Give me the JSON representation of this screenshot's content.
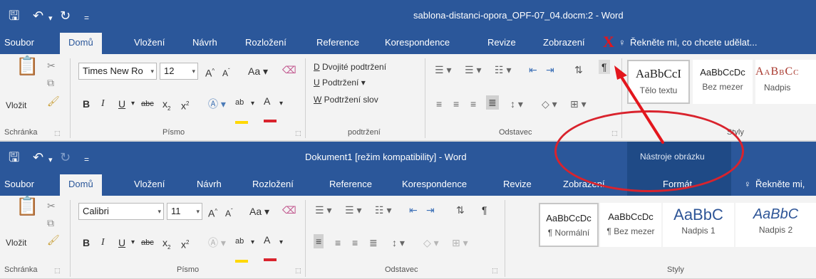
{
  "top_window": {
    "title": "sablona-distanci-opora_OPF-07_04.docm:2 - Word",
    "tabs": [
      "Soubor",
      "Domů",
      "Vložení",
      "Návrh",
      "Rozložení",
      "Reference",
      "Korespondence",
      "Revize",
      "Zobrazení"
    ],
    "tell_me": "Řekněte mi, co chcete udělat...",
    "clipboard": {
      "paste": "Vložit",
      "label": "Schránka"
    },
    "font": {
      "name": "Times New Ro",
      "size": "12",
      "change_case": "Aa",
      "label": "Písmo"
    },
    "underline_group": {
      "double": "Dvojité podtržení",
      "single": "Podtržení",
      "words": "Podtržení slov",
      "key_double": "D",
      "key_single": "U",
      "key_words": "W",
      "label": "podtržení"
    },
    "paragraph": {
      "label": "Odstavec"
    },
    "styles": {
      "items": [
        {
          "sample": "AaBbCcI",
          "name": "Tělo textu"
        },
        {
          "sample": "AaBbCcDc",
          "name": "Bez mezer"
        },
        {
          "sample": "AaBbCc",
          "name": "Nadpis"
        }
      ],
      "label": "Styly"
    }
  },
  "bottom_window": {
    "title": "Dokument1 [režim kompatibility] - Word",
    "contextual_group": "Nástroje obrázku",
    "tabs": [
      "Soubor",
      "Domů",
      "Vložení",
      "Návrh",
      "Rozložení",
      "Reference",
      "Korespondence",
      "Revize",
      "Zobrazení",
      "Formát"
    ],
    "tell_me": "Řekněte mi,",
    "clipboard": {
      "paste": "Vložit",
      "label": "Schránka"
    },
    "font": {
      "name": "Calibri",
      "size": "11",
      "change_case": "Aa",
      "label": "Písmo"
    },
    "paragraph": {
      "label": "Odstavec"
    },
    "styles": {
      "items": [
        {
          "sample": "AaBbCcDc",
          "name": "¶ Normální"
        },
        {
          "sample": "AaBbCcDc",
          "name": "¶ Bez mezer"
        },
        {
          "sample": "AaBbC",
          "name": "Nadpis 1"
        },
        {
          "sample": "AaBbC",
          "name": "Nadpis 2"
        }
      ],
      "label": "Styly"
    }
  },
  "annotation": {
    "mark": "X",
    "color": "#e3161d"
  },
  "colors": {
    "title_bar": "#2b579a",
    "ribbon": "#f3f3f3",
    "highlight_yellow": "#ffd800",
    "font_red": "#d9232d",
    "annotation_red": "#d9232d"
  },
  "icons": [
    "save-icon",
    "undo-icon",
    "redo-icon",
    "customize-icon",
    "lightbulb-icon",
    "paste-icon",
    "cut-icon",
    "copy-icon",
    "format-painter-icon",
    "show-marks-icon",
    "sort-icon"
  ]
}
